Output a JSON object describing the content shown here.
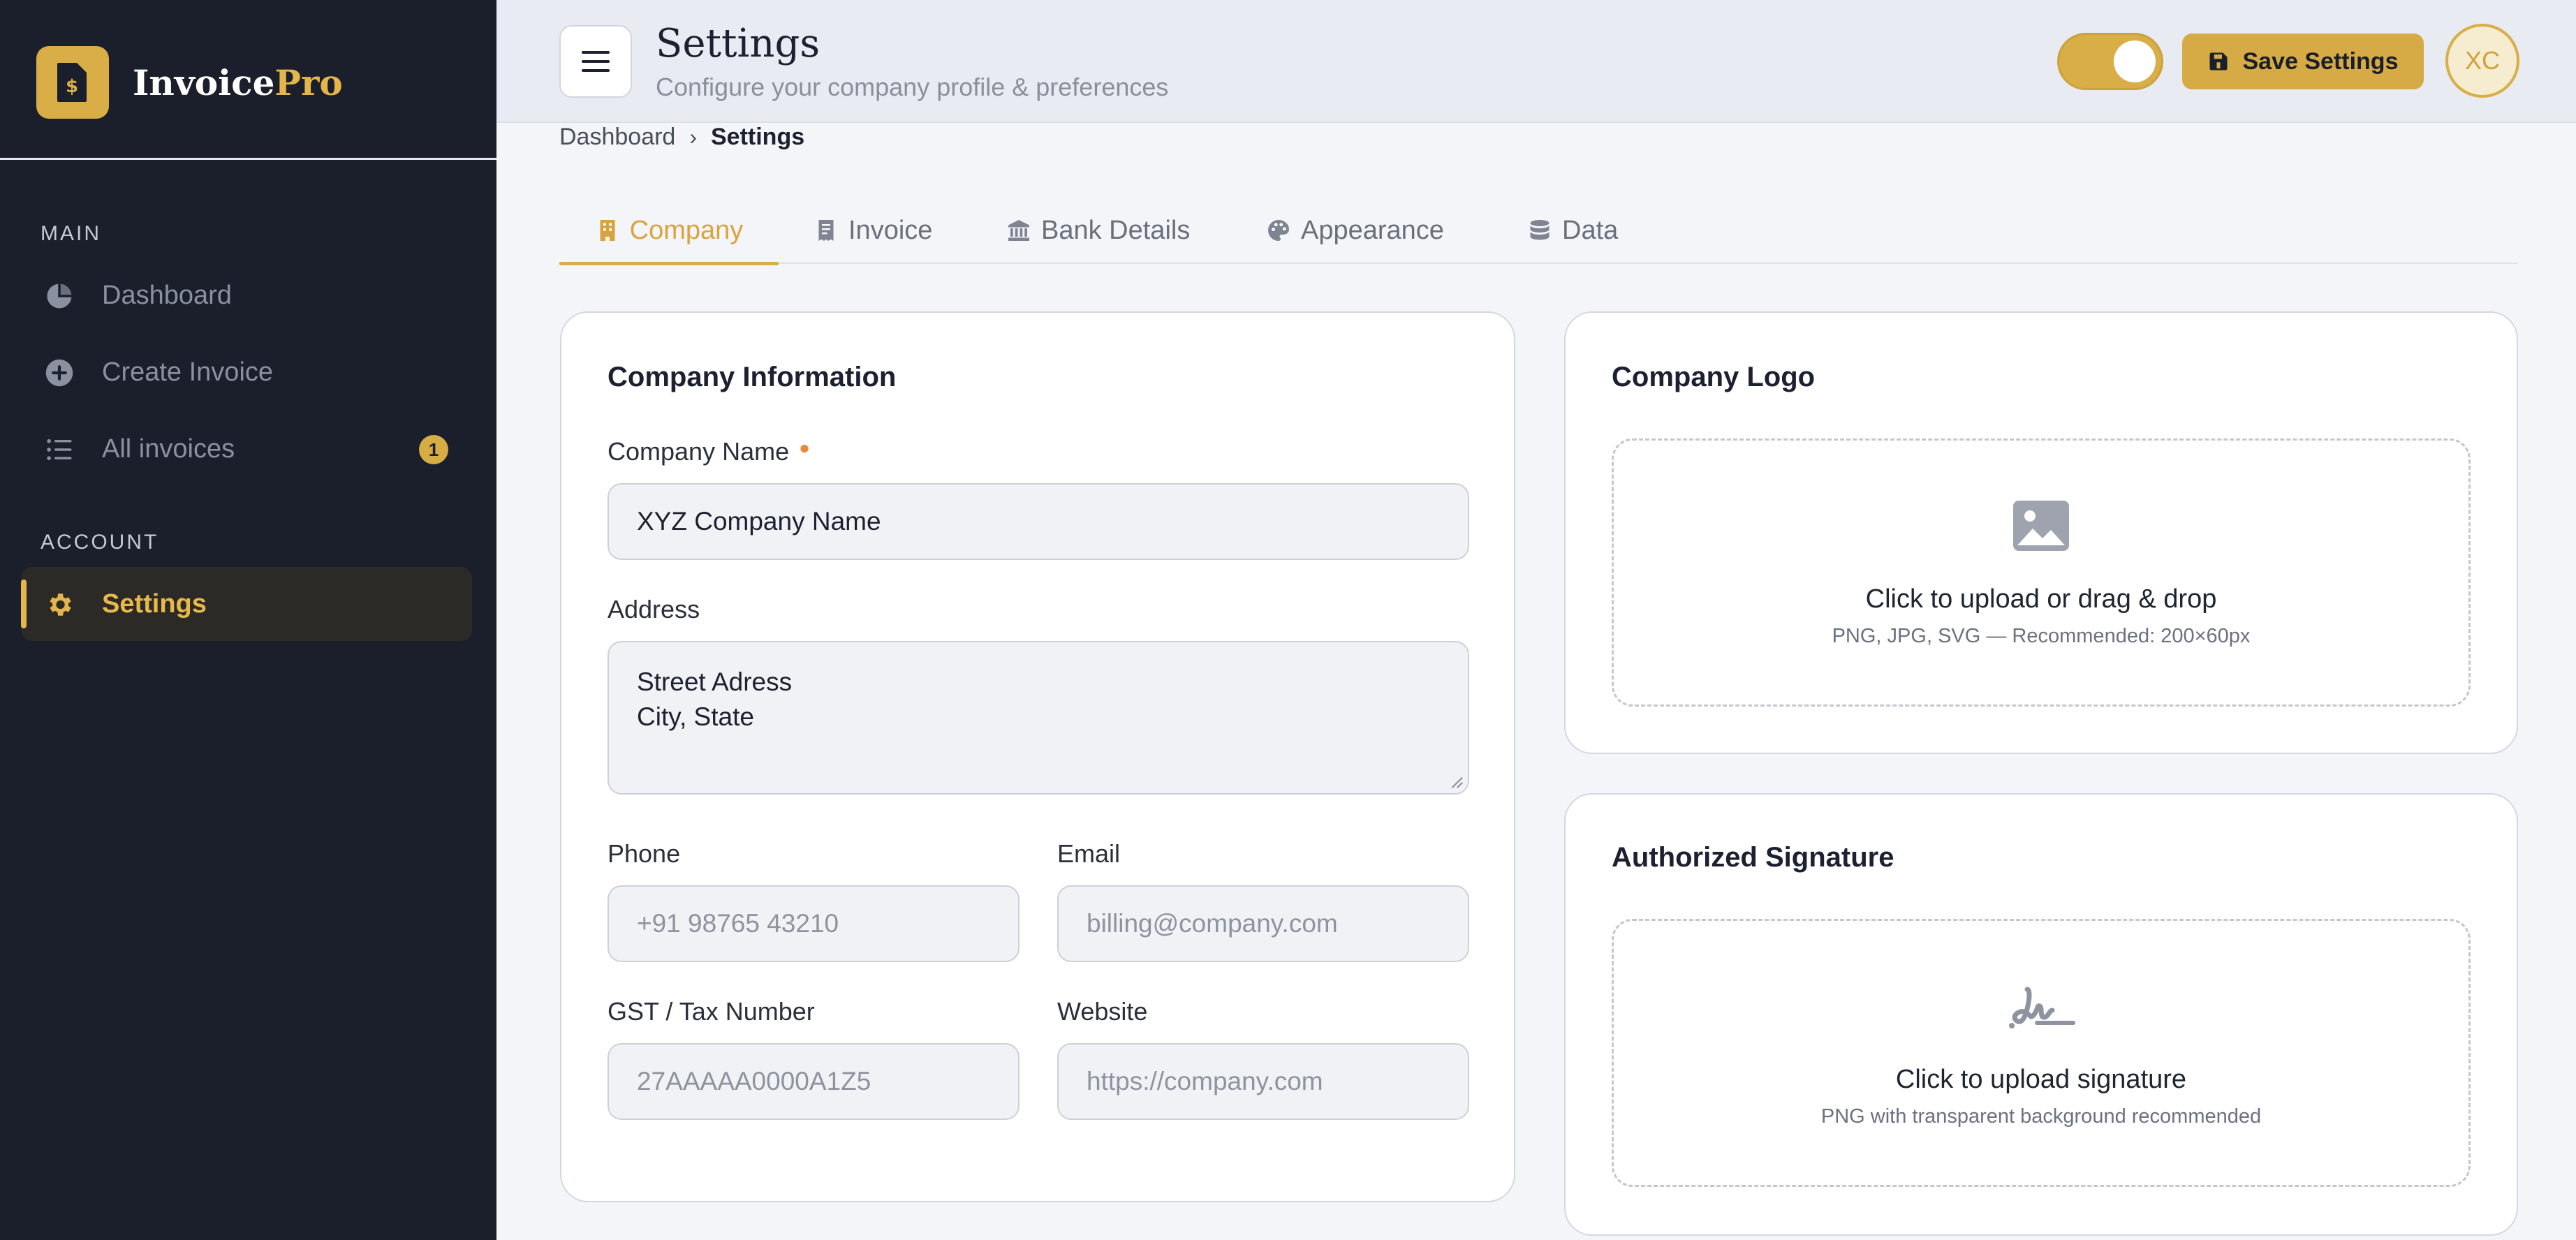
{
  "brand": {
    "name_main": "Invoice",
    "name_accent": "Pro",
    "logo_icon": "invoice-file-icon"
  },
  "colors": {
    "accent": "#d9ae47",
    "sidebar_bg": "#1b1f2c",
    "page_bg": "#f4f5f9",
    "required": "#e8883a"
  },
  "sidebar": {
    "main_heading": "MAIN",
    "account_heading": "ACCOUNT",
    "items": [
      {
        "label": "Dashboard",
        "icon": "pie-chart-icon",
        "active": false
      },
      {
        "label": "Create Invoice",
        "icon": "plus-circle-icon",
        "active": false
      },
      {
        "label": "All invoices",
        "icon": "list-icon",
        "active": false,
        "badge": "1"
      },
      {
        "label": "Settings",
        "icon": "gear-icon",
        "active": true
      }
    ]
  },
  "header": {
    "title": "Settings",
    "subtitle": "Configure your company profile & preferences",
    "save_label": "Save Settings",
    "avatar_initials": "XC",
    "theme_toggle_on": true
  },
  "breadcrumb": {
    "parent": "Dashboard",
    "current": "Settings"
  },
  "tabs": [
    {
      "label": "Company",
      "icon": "building-icon",
      "active": true
    },
    {
      "label": "Invoice",
      "icon": "receipt-icon",
      "active": false
    },
    {
      "label": "Bank Details",
      "icon": "bank-icon",
      "active": false
    },
    {
      "label": "Appearance",
      "icon": "palette-icon",
      "active": false
    },
    {
      "label": "Data",
      "icon": "database-icon",
      "active": false
    }
  ],
  "company_info": {
    "title": "Company Information",
    "company_name_label": "Company Name",
    "company_name_value": "XYZ Company Name",
    "address_label": "Address",
    "address_line1": "Street Adress",
    "address_line2": "City, State",
    "phone_label": "Phone",
    "phone_placeholder": "+91 98765 43210",
    "email_label": "Email",
    "email_value": "billing@company.com",
    "gst_label": "GST / Tax Number",
    "gst_placeholder": "27AAAAA0000A1Z5",
    "website_label": "Website",
    "website_value": "https://company.com"
  },
  "company_logo": {
    "title": "Company Logo",
    "upload_text": "Click to upload or drag & drop",
    "hint": "PNG, JPG, SVG — Recommended: 200×60px"
  },
  "signature": {
    "title": "Authorized Signature",
    "upload_text": "Click to upload signature",
    "hint": "PNG with transparent background recommended"
  }
}
